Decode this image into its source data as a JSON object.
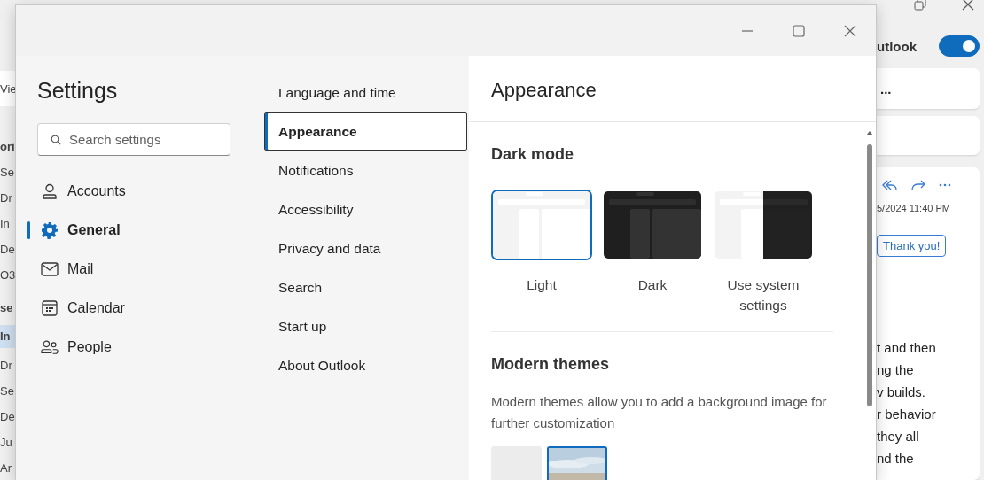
{
  "background_app": {
    "view_fragment": "Vie",
    "nav_fragments": [
      {
        "label": "ori",
        "kind": "header",
        "selected": false
      },
      {
        "label": "Se",
        "kind": "item",
        "selected": false
      },
      {
        "label": "Dr",
        "kind": "item",
        "selected": false
      },
      {
        "label": "In",
        "kind": "item",
        "selected": false
      },
      {
        "label": "De",
        "kind": "item",
        "selected": false
      },
      {
        "label": "O3",
        "kind": "item",
        "selected": false
      },
      {
        "label": "se",
        "kind": "header",
        "selected": false
      },
      {
        "label": "In",
        "kind": "item",
        "selected": true
      },
      {
        "label": "Dr",
        "kind": "item",
        "selected": false
      },
      {
        "label": "Se",
        "kind": "item",
        "selected": false
      },
      {
        "label": "De",
        "kind": "item",
        "selected": false
      },
      {
        "label": "Ju",
        "kind": "item",
        "selected": false
      },
      {
        "label": "Ar",
        "kind": "item",
        "selected": false
      }
    ],
    "toggle": {
      "label": "utlook",
      "on": true
    },
    "card_more": "...",
    "message": {
      "date": "5/2024 11:40 PM",
      "quick_reply": "Thank you!",
      "body_lines": [
        "t and then",
        "ng the",
        "v builds.",
        "r behavior",
        "they all",
        "nd the"
      ]
    }
  },
  "dialog": {
    "title": "Settings",
    "search": {
      "placeholder": "Search settings"
    },
    "categories": [
      {
        "label": "Accounts",
        "selected": false
      },
      {
        "label": "General",
        "selected": true
      },
      {
        "label": "Mail",
        "selected": false
      },
      {
        "label": "Calendar",
        "selected": false
      },
      {
        "label": "People",
        "selected": false
      }
    ],
    "subcategories": [
      {
        "label": "Language and time",
        "selected": false
      },
      {
        "label": "Appearance",
        "selected": true
      },
      {
        "label": "Notifications",
        "selected": false
      },
      {
        "label": "Accessibility",
        "selected": false
      },
      {
        "label": "Privacy and data",
        "selected": false
      },
      {
        "label": "Search",
        "selected": false
      },
      {
        "label": "Start up",
        "selected": false
      },
      {
        "label": "About Outlook",
        "selected": false
      }
    ],
    "pane_title": "Appearance",
    "dark_mode": {
      "heading": "Dark mode",
      "options": [
        {
          "label": "Light",
          "kind": "light",
          "selected": true
        },
        {
          "label": "Dark",
          "kind": "dark",
          "selected": false
        },
        {
          "label": "Use system settings",
          "kind": "system",
          "selected": false
        }
      ]
    },
    "modern_themes": {
      "heading": "Modern themes",
      "description": "Modern themes allow you to add a background image for further customization",
      "tiles": [
        {
          "kind": "plain",
          "selected": false
        },
        {
          "kind": "picture",
          "selected": true
        }
      ]
    }
  }
}
